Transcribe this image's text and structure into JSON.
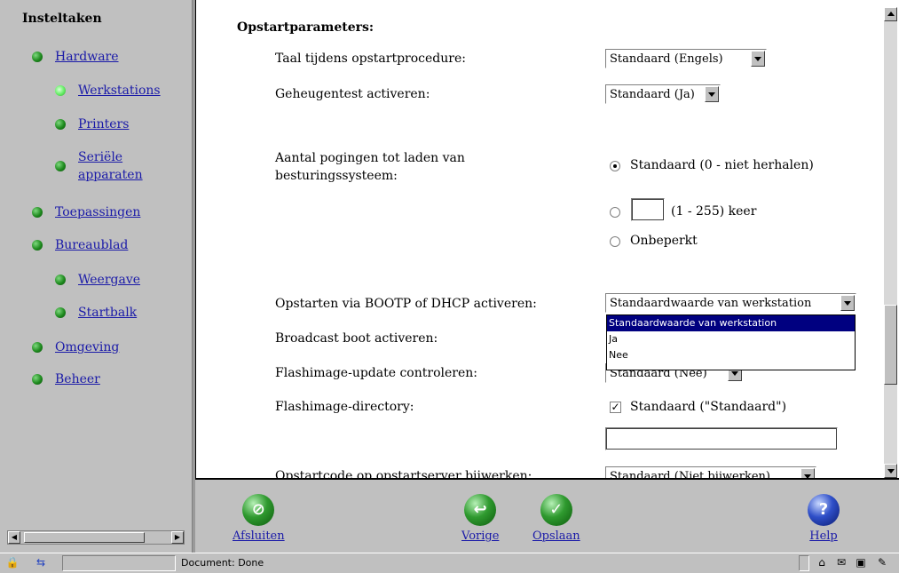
{
  "sidebar": {
    "title": "Insteltaken",
    "items": [
      {
        "label": "Hardware"
      },
      {
        "label": "Werkstations"
      },
      {
        "label": "Printers"
      },
      {
        "label": "Seriële"
      },
      {
        "label": "apparaten"
      },
      {
        "label": "Toepassingen"
      },
      {
        "label": "Bureaublad"
      },
      {
        "label": "Weergave"
      },
      {
        "label": "Startbalk"
      },
      {
        "label": "Omgeving"
      },
      {
        "label": "Beheer"
      }
    ]
  },
  "content": {
    "section_title": "Opstartparameters:",
    "language": {
      "label": "Taal tijdens opstartprocedure:",
      "value": "Standaard (Engels)"
    },
    "memtest": {
      "label": "Geheugentest activeren:",
      "value": "Standaard (Ja)"
    },
    "attempts": {
      "label_line1": "Aantal pogingen tot laden van",
      "label_line2": "besturingssysteem:",
      "opt_default": "Standaard (0 - niet herhalen)",
      "opt_range": "(1 - 255) keer",
      "opt_range_value": "",
      "opt_unlimited": "Onbeperkt"
    },
    "bootp": {
      "label": "Opstarten via BOOTP of DHCP activeren:",
      "value": "Standaardwaarde van werkstation",
      "options": [
        "Standaardwaarde van werkstation",
        "Ja",
        "Nee"
      ]
    },
    "broadcast": {
      "label": "Broadcast boot activeren:"
    },
    "flash_update": {
      "label": "Flashimage-update controleren:",
      "value": "Standaard (Nee)"
    },
    "flash_dir": {
      "label": "Flashimage-directory:",
      "check_label": "Standaard (\"Standaard\")",
      "check_mark": "✓",
      "input_value": ""
    },
    "boot_code": {
      "label": "Opstartcode op opstartserver bijwerken:",
      "value": "Standaard (Niet bijwerken)"
    }
  },
  "footer": {
    "close": "Afsluiten",
    "next": "Vorige",
    "save": "Opslaan",
    "help": "Help"
  },
  "statusbar": {
    "text": "Document: Done"
  }
}
